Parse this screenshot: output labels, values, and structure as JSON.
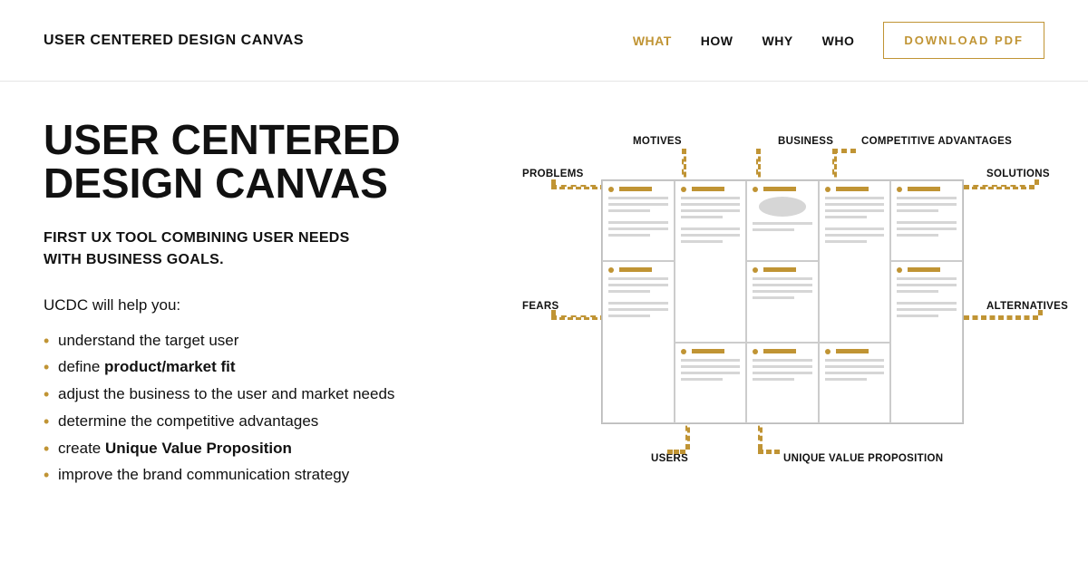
{
  "header": {
    "logo": "USER CENTERED DESIGN CANVAS",
    "nav": [
      "WHAT",
      "HOW",
      "WHY",
      "WHO"
    ],
    "nav_active_index": 0,
    "download_label": "DOWNLOAD PDF"
  },
  "hero": {
    "title_line1": "USER CENTERED",
    "title_line2": "DESIGN CANVAS",
    "subtitle_line1": "FIRST UX TOOL COMBINING USER NEEDS",
    "subtitle_line2": "WITH BUSINESS GOALS.",
    "intro": "UCDC will help you:",
    "bullets": [
      {
        "pre": "understand the target user",
        "bold": "",
        "post": ""
      },
      {
        "pre": "define ",
        "bold": "product/market fit",
        "post": ""
      },
      {
        "pre": "adjust the business to the user and market needs",
        "bold": "",
        "post": ""
      },
      {
        "pre": "determine the competitive advantages",
        "bold": "",
        "post": ""
      },
      {
        "pre": "create ",
        "bold": "Unique Value Proposition",
        "post": ""
      },
      {
        "pre": "improve the brand communication strategy",
        "bold": "",
        "post": ""
      }
    ]
  },
  "diagram": {
    "labels": {
      "motives": "MOTIVES",
      "business": "BUSINESS",
      "competitive_advantages": "COMPETITIVE ADVANTAGES",
      "problems": "PROBLEMS",
      "solutions": "SOLUTIONS",
      "fears": "FEARS",
      "alternatives": "ALTERNATIVES",
      "users": "USERS",
      "uvp": "UNIQUE VALUE PROPOSITION"
    }
  },
  "colors": {
    "accent": "#c09434"
  }
}
